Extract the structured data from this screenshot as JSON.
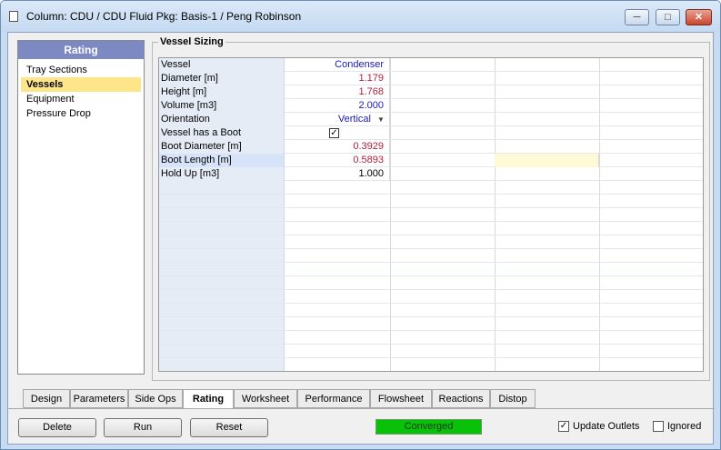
{
  "window": {
    "title": "Column: CDU / CDU  Fluid Pkg: Basis-1 / Peng Robinson",
    "min_label": "─",
    "max_label": "□",
    "close_label": "✕"
  },
  "nav": {
    "header": "Rating",
    "items": [
      {
        "label": "Tray Sections",
        "selected": false
      },
      {
        "label": "Vessels",
        "selected": true
      },
      {
        "label": "Equipment",
        "selected": false
      },
      {
        "label": "Pressure Drop",
        "selected": false
      }
    ]
  },
  "vessel_sizing": {
    "group_label": "Vessel Sizing",
    "rows": [
      {
        "label": "Vessel",
        "value": "Condenser"
      },
      {
        "label": "Diameter [m]",
        "value": "1.179"
      },
      {
        "label": "Height [m]",
        "value": "1.768"
      },
      {
        "label": "Volume [m3]",
        "value": "2.000"
      },
      {
        "label": "Orientation",
        "value": "Vertical"
      },
      {
        "label": "Vessel has a Boot",
        "value": "✓"
      },
      {
        "label": "Boot Diameter [m]",
        "value": "0.3929"
      },
      {
        "label": "Boot Length [m]",
        "value": "0.5893"
      },
      {
        "label": "Hold Up [m3]",
        "value": "1.000"
      }
    ]
  },
  "tabs": [
    "Design",
    "Parameters",
    "Side Ops",
    "Rating",
    "Worksheet",
    "Performance",
    "Flowsheet",
    "Reactions",
    "Distop"
  ],
  "active_tab": "Rating",
  "buttons": {
    "delete": "Delete",
    "run": "Run",
    "reset": "Reset"
  },
  "status": {
    "text": "Converged",
    "color": "#0ac10a"
  },
  "options": {
    "update_outlets": {
      "label": "Update Outlets",
      "checked": true
    },
    "ignored": {
      "label": "Ignored",
      "checked": false
    }
  }
}
